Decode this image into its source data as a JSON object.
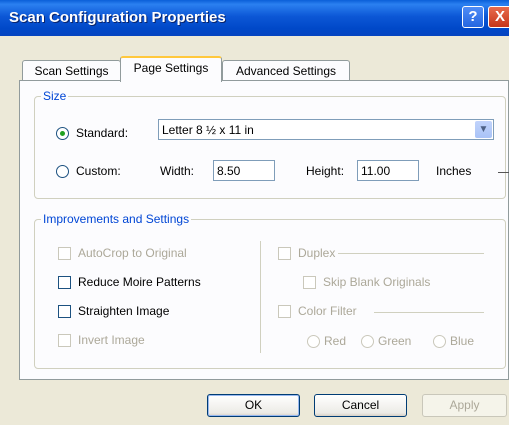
{
  "window": {
    "title": "Scan Configuration Properties",
    "help_label": "?",
    "close_label": "X"
  },
  "tabs": [
    {
      "label": "Scan Settings"
    },
    {
      "label": "Page Settings"
    },
    {
      "label": "Advanced Settings"
    }
  ],
  "size": {
    "legend": "Size",
    "standard_label": "Standard:",
    "standard_selected": true,
    "standard_value": "Letter 8 ½ x 11 in",
    "custom_label": "Custom:",
    "width_label": "Width:",
    "width_value": "8.50",
    "height_label": "Height:",
    "height_value": "11.00",
    "units": "Inches"
  },
  "improvements": {
    "legend": "Improvements and Settings",
    "autocrop": {
      "label": "AutoCrop to Original",
      "enabled": false,
      "checked": false
    },
    "reduce_moire": {
      "label": "Reduce Moire Patterns",
      "enabled": true,
      "checked": false
    },
    "straighten": {
      "label": "Straighten Image",
      "enabled": true,
      "checked": false
    },
    "invert": {
      "label": "Invert Image",
      "enabled": false,
      "checked": false
    },
    "duplex": {
      "label": "Duplex",
      "enabled": false,
      "checked": false
    },
    "skip_blank": {
      "label": "Skip Blank Originals",
      "enabled": false,
      "checked": false
    },
    "color_filter": {
      "label": "Color Filter",
      "enabled": false,
      "checked": false
    },
    "filters": [
      {
        "label": "Red"
      },
      {
        "label": "Green"
      },
      {
        "label": "Blue"
      }
    ]
  },
  "buttons": {
    "ok": "OK",
    "cancel": "Cancel",
    "apply": "Apply"
  },
  "colors": {
    "title_bar": "#0054e3",
    "group_legend": "#0046d5",
    "disabled_text": "#aca899",
    "dialog_bg": "#ece9d8"
  }
}
